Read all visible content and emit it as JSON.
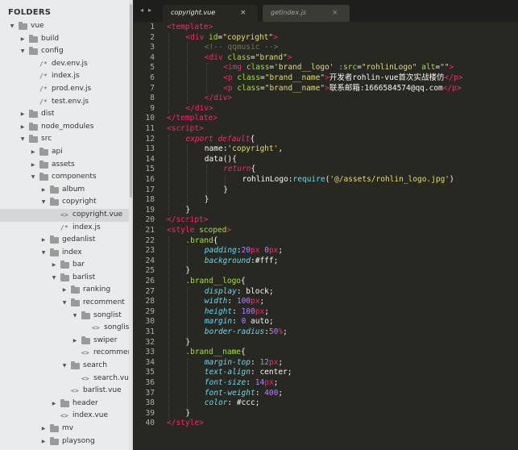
{
  "sidebar": {
    "title": "FOLDERS",
    "items": [
      {
        "label": "vue",
        "kind": "folder",
        "depth": 0,
        "expanded": true
      },
      {
        "label": "build",
        "kind": "folder",
        "depth": 1,
        "expanded": false
      },
      {
        "label": "config",
        "kind": "folder",
        "depth": 1,
        "expanded": true
      },
      {
        "label": "dev.env.js",
        "kind": "js",
        "depth": 2
      },
      {
        "label": "index.js",
        "kind": "js",
        "depth": 2
      },
      {
        "label": "prod.env.js",
        "kind": "js",
        "depth": 2
      },
      {
        "label": "test.env.js",
        "kind": "js",
        "depth": 2
      },
      {
        "label": "dist",
        "kind": "folder",
        "depth": 1,
        "expanded": false
      },
      {
        "label": "node_modules",
        "kind": "folder",
        "depth": 1,
        "expanded": false
      },
      {
        "label": "src",
        "kind": "folder",
        "depth": 1,
        "expanded": true
      },
      {
        "label": "api",
        "kind": "folder",
        "depth": 2,
        "expanded": false
      },
      {
        "label": "assets",
        "kind": "folder",
        "depth": 2,
        "expanded": false
      },
      {
        "label": "components",
        "kind": "folder",
        "depth": 2,
        "expanded": true
      },
      {
        "label": "album",
        "kind": "folder",
        "depth": 3,
        "expanded": false
      },
      {
        "label": "copyright",
        "kind": "folder",
        "depth": 3,
        "expanded": true
      },
      {
        "label": "copyright.vue",
        "kind": "vue",
        "depth": 4,
        "selected": true
      },
      {
        "label": "index.js",
        "kind": "js",
        "depth": 4
      },
      {
        "label": "gedanlist",
        "kind": "folder",
        "depth": 3,
        "expanded": false
      },
      {
        "label": "index",
        "kind": "folder",
        "depth": 3,
        "expanded": true
      },
      {
        "label": "bar",
        "kind": "folder",
        "depth": 4,
        "expanded": false
      },
      {
        "label": "barlist",
        "kind": "folder",
        "depth": 4,
        "expanded": true
      },
      {
        "label": "ranking",
        "kind": "folder",
        "depth": 5,
        "expanded": false
      },
      {
        "label": "recomment",
        "kind": "folder",
        "depth": 5,
        "expanded": true
      },
      {
        "label": "songlist",
        "kind": "folder",
        "depth": 6,
        "expanded": true
      },
      {
        "label": "songlist.vue",
        "kind": "vue",
        "depth": 7
      },
      {
        "label": "swiper",
        "kind": "folder",
        "depth": 6,
        "expanded": false
      },
      {
        "label": "recomment.vue",
        "kind": "vue",
        "depth": 6
      },
      {
        "label": "search",
        "kind": "folder",
        "depth": 5,
        "expanded": true
      },
      {
        "label": "search.vue",
        "kind": "vue",
        "depth": 6
      },
      {
        "label": "barlist.vue",
        "kind": "vue",
        "depth": 5
      },
      {
        "label": "header",
        "kind": "folder",
        "depth": 4,
        "expanded": false
      },
      {
        "label": "index.vue",
        "kind": "vue",
        "depth": 4
      },
      {
        "label": "mv",
        "kind": "folder",
        "depth": 3,
        "expanded": false
      },
      {
        "label": "playsong",
        "kind": "folder",
        "depth": 3,
        "expanded": false
      }
    ]
  },
  "tabs": [
    {
      "label": "copyright.vue",
      "active": true
    },
    {
      "label": "getindex.js",
      "active": false
    }
  ],
  "nav": {
    "back": "◂",
    "forward": "▸"
  },
  "icons": {
    "close": "×",
    "js_file": "/*",
    "vue_file": "<>",
    "collapsed": "▶",
    "expanded": "▼"
  },
  "colors": {
    "tag": "#f92672",
    "attr": "#a6e22e",
    "string": "#e6db74",
    "comment": "#75715e",
    "number": "#ae81ff",
    "property": "#66d9ef",
    "text": "#f8f8f2",
    "background": "#272822"
  },
  "editor": {
    "lines": [
      {
        "n": "1",
        "i": 0,
        "seg": [
          [
            "<",
            "tag"
          ],
          [
            "template",
            "tag"
          ],
          [
            ">",
            "tag"
          ]
        ]
      },
      {
        "n": "2",
        "i": 1,
        "seg": [
          [
            "<",
            "tag"
          ],
          [
            "div",
            "tag"
          ],
          [
            " id",
            "attr"
          ],
          [
            "=",
            "text"
          ],
          [
            "\"copyright\"",
            "str"
          ],
          [
            ">",
            "tag"
          ]
        ]
      },
      {
        "n": "3",
        "i": 2,
        "seg": [
          [
            "<!-- qqmusic -->",
            "cmt"
          ]
        ]
      },
      {
        "n": "4",
        "i": 2,
        "seg": [
          [
            "<",
            "tag"
          ],
          [
            "div",
            "tag"
          ],
          [
            " class",
            "attr"
          ],
          [
            "=",
            "text"
          ],
          [
            "\"brand\"",
            "str"
          ],
          [
            ">",
            "tag"
          ]
        ]
      },
      {
        "n": "5",
        "i": 3,
        "seg": [
          [
            "<",
            "tag"
          ],
          [
            "img",
            "tag"
          ],
          [
            " class",
            "attr"
          ],
          [
            "=",
            "text"
          ],
          [
            "'brand__logo'",
            "str"
          ],
          [
            " :src",
            "attr"
          ],
          [
            "=",
            "text"
          ],
          [
            "\"rohlinLogo\"",
            "str"
          ],
          [
            " alt",
            "attr"
          ],
          [
            "=",
            "text"
          ],
          [
            "\"\"",
            "str"
          ],
          [
            ">",
            "tag"
          ]
        ]
      },
      {
        "n": "6",
        "i": 3,
        "seg": [
          [
            "<",
            "tag"
          ],
          [
            "p",
            "tag"
          ],
          [
            " class",
            "attr"
          ],
          [
            "=",
            "text"
          ],
          [
            "\"brand__name\"",
            "str"
          ],
          [
            ">",
            "tag"
          ],
          [
            "开发者rohlin-vue首次实战楼仿",
            "text"
          ],
          [
            "</",
            "tag"
          ],
          [
            "p",
            "tag"
          ],
          [
            ">",
            "tag"
          ]
        ]
      },
      {
        "n": "7",
        "i": 3,
        "seg": [
          [
            "<",
            "tag"
          ],
          [
            "p",
            "tag"
          ],
          [
            " class",
            "attr"
          ],
          [
            "=",
            "text"
          ],
          [
            "\"brand__name\"",
            "str"
          ],
          [
            ">",
            "tag"
          ],
          [
            "联系邮箱:1666584574@qq.com",
            "text"
          ],
          [
            "</",
            "tag"
          ],
          [
            "p",
            "tag"
          ],
          [
            ">",
            "tag"
          ]
        ]
      },
      {
        "n": "8",
        "i": 2,
        "seg": [
          [
            "</",
            "tag"
          ],
          [
            "div",
            "tag"
          ],
          [
            ">",
            "tag"
          ]
        ]
      },
      {
        "n": "9",
        "i": 1,
        "seg": [
          [
            "</",
            "tag"
          ],
          [
            "div",
            "tag"
          ],
          [
            ">",
            "tag"
          ]
        ]
      },
      {
        "n": "10",
        "i": 0,
        "seg": [
          [
            "</",
            "tag"
          ],
          [
            "template",
            "tag"
          ],
          [
            ">",
            "tag"
          ]
        ]
      },
      {
        "n": "11",
        "i": 0,
        "seg": [
          [
            "<",
            "tag"
          ],
          [
            "script",
            "tag"
          ],
          [
            ">",
            "tag"
          ]
        ]
      },
      {
        "n": "12",
        "i": 1,
        "seg": [
          [
            "export",
            "kw"
          ],
          [
            " ",
            "text"
          ],
          [
            "default",
            "kw"
          ],
          [
            "{",
            "text"
          ]
        ]
      },
      {
        "n": "13",
        "i": 2,
        "seg": [
          [
            "name",
            "text"
          ],
          [
            ":",
            "text"
          ],
          [
            "'copyright'",
            "str"
          ],
          [
            ",",
            "text"
          ]
        ]
      },
      {
        "n": "14",
        "i": 2,
        "seg": [
          [
            "data",
            "text"
          ],
          [
            "(){",
            "text"
          ]
        ]
      },
      {
        "n": "15",
        "i": 3,
        "seg": [
          [
            "return",
            "kw"
          ],
          [
            "{",
            "text"
          ]
        ]
      },
      {
        "n": "16",
        "i": 4,
        "seg": [
          [
            "rohlinLogo",
            "text"
          ],
          [
            ":",
            "text"
          ],
          [
            "require",
            "func"
          ],
          [
            "(",
            "text"
          ],
          [
            "'@/assets/rohlin_logo.jpg'",
            "str"
          ],
          [
            ")",
            "text"
          ]
        ]
      },
      {
        "n": "17",
        "i": 3,
        "seg": [
          [
            "}",
            "text"
          ]
        ]
      },
      {
        "n": "18",
        "i": 2,
        "seg": [
          [
            "}",
            "text"
          ]
        ]
      },
      {
        "n": "19",
        "i": 1,
        "seg": [
          [
            "}",
            "text"
          ]
        ]
      },
      {
        "n": "20",
        "i": 0,
        "seg": [
          [
            "</",
            "tag"
          ],
          [
            "script",
            "tag"
          ],
          [
            ">",
            "tag"
          ]
        ]
      },
      {
        "n": "21",
        "i": 0,
        "seg": [
          [
            "<",
            "tag"
          ],
          [
            "style",
            "tag"
          ],
          [
            " scoped",
            "attr"
          ],
          [
            ">",
            "tag"
          ]
        ]
      },
      {
        "n": "22",
        "i": 1,
        "seg": [
          [
            ".brand",
            "sel"
          ],
          [
            "{",
            "text"
          ]
        ]
      },
      {
        "n": "23",
        "i": 2,
        "seg": [
          [
            "padding",
            "prop"
          ],
          [
            ":",
            "text"
          ],
          [
            "20",
            "num"
          ],
          [
            "px",
            "tag"
          ],
          [
            " ",
            "text"
          ],
          [
            "0",
            "num"
          ],
          [
            "px",
            "tag"
          ],
          [
            ";",
            "text"
          ]
        ]
      },
      {
        "n": "24",
        "i": 2,
        "seg": [
          [
            "background",
            "prop"
          ],
          [
            ":",
            "text"
          ],
          [
            "#fff",
            "text"
          ],
          [
            ";",
            "text"
          ]
        ]
      },
      {
        "n": "25",
        "i": 1,
        "seg": [
          [
            "}",
            "text"
          ]
        ]
      },
      {
        "n": "26",
        "i": 1,
        "seg": [
          [
            ".brand__logo",
            "sel"
          ],
          [
            "{",
            "text"
          ]
        ]
      },
      {
        "n": "27",
        "i": 2,
        "seg": [
          [
            "display",
            "prop"
          ],
          [
            ": ",
            "text"
          ],
          [
            "block",
            "text"
          ],
          [
            ";",
            "text"
          ]
        ]
      },
      {
        "n": "28",
        "i": 2,
        "seg": [
          [
            "width",
            "prop"
          ],
          [
            ": ",
            "text"
          ],
          [
            "100",
            "num"
          ],
          [
            "px",
            "tag"
          ],
          [
            ";",
            "text"
          ]
        ]
      },
      {
        "n": "29",
        "i": 2,
        "seg": [
          [
            "height",
            "prop"
          ],
          [
            ": ",
            "text"
          ],
          [
            "100",
            "num"
          ],
          [
            "px",
            "tag"
          ],
          [
            ";",
            "text"
          ]
        ]
      },
      {
        "n": "30",
        "i": 2,
        "seg": [
          [
            "margin",
            "prop"
          ],
          [
            ": ",
            "text"
          ],
          [
            "0",
            "num"
          ],
          [
            " auto",
            "text"
          ],
          [
            ";",
            "text"
          ]
        ]
      },
      {
        "n": "31",
        "i": 2,
        "seg": [
          [
            "border-radius",
            "prop"
          ],
          [
            ":",
            "text"
          ],
          [
            "50",
            "num"
          ],
          [
            "%",
            "tag"
          ],
          [
            ";",
            "text"
          ]
        ]
      },
      {
        "n": "32",
        "i": 1,
        "seg": [
          [
            "}",
            "text"
          ]
        ]
      },
      {
        "n": "33",
        "i": 1,
        "seg": [
          [
            ".brand__name",
            "sel"
          ],
          [
            "{",
            "text"
          ]
        ]
      },
      {
        "n": "34",
        "i": 2,
        "seg": [
          [
            "margin-top",
            "prop"
          ],
          [
            ": ",
            "text"
          ],
          [
            "12",
            "num"
          ],
          [
            "px",
            "tag"
          ],
          [
            ";",
            "text"
          ]
        ]
      },
      {
        "n": "35",
        "i": 2,
        "seg": [
          [
            "text-align",
            "prop"
          ],
          [
            ": ",
            "text"
          ],
          [
            "center",
            "text"
          ],
          [
            ";",
            "text"
          ]
        ]
      },
      {
        "n": "36",
        "i": 2,
        "seg": [
          [
            "font-size",
            "prop"
          ],
          [
            ": ",
            "text"
          ],
          [
            "14",
            "num"
          ],
          [
            "px",
            "tag"
          ],
          [
            ";",
            "text"
          ]
        ]
      },
      {
        "n": "37",
        "i": 2,
        "seg": [
          [
            "font-weight",
            "prop"
          ],
          [
            ": ",
            "text"
          ],
          [
            "400",
            "num"
          ],
          [
            ";",
            "text"
          ]
        ]
      },
      {
        "n": "38",
        "i": 2,
        "seg": [
          [
            "color",
            "prop"
          ],
          [
            ": ",
            "text"
          ],
          [
            "#ccc",
            "text"
          ],
          [
            ";",
            "text"
          ]
        ]
      },
      {
        "n": "39",
        "i": 1,
        "seg": [
          [
            "}",
            "text"
          ]
        ]
      },
      {
        "n": "40",
        "i": 0,
        "seg": [
          [
            "</",
            "tag"
          ],
          [
            "style",
            "tag"
          ],
          [
            ">",
            "tag"
          ]
        ]
      }
    ]
  }
}
